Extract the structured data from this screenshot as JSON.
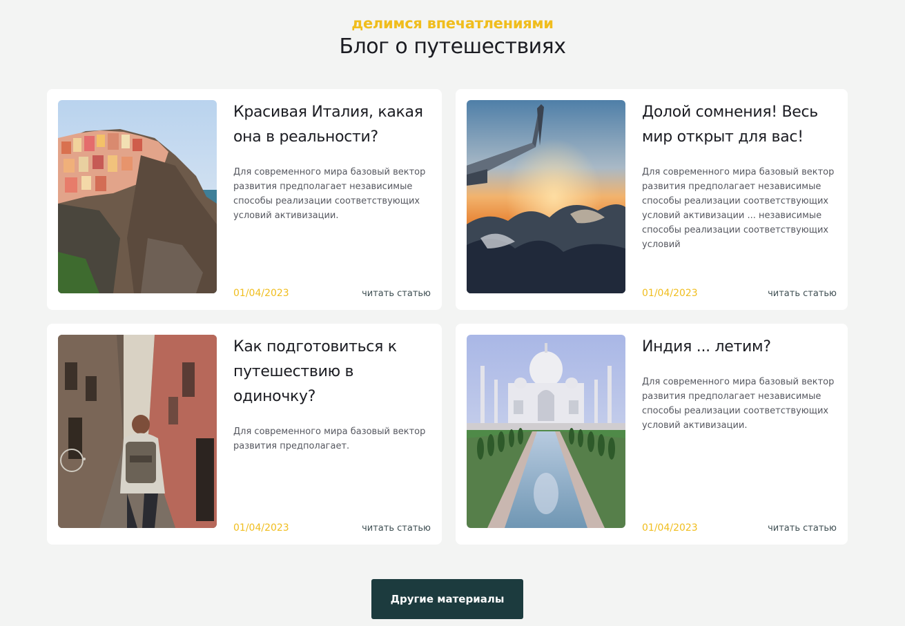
{
  "header": {
    "eyebrow": "делимся впечатлениями",
    "title": "Блог о путешествиях"
  },
  "posts": [
    {
      "image_icon": "italy-coast-photo",
      "title": "Красивая Италия, какая она в реальности?",
      "text": "Для современного мира базовый вектор развития предполагает независимые способы реализации соответствующих условий активизации.",
      "date": "01/04/2023",
      "link": "читать статью"
    },
    {
      "image_icon": "airplane-wing-photo",
      "title": "Долой сомнения! Весь мир открыт для вас!",
      "text": "Для современного мира базовый вектор развития предполагает независимые способы реализации соответствующих условий активизации ... независимые способы реализации соответствующих условий",
      "date": "01/04/2023",
      "link": "читать статью"
    },
    {
      "image_icon": "traveler-alley-photo",
      "title": "Как подготовиться к путешествию в одиночку?",
      "text": "Для современного мира базовый вектор развития предполагает.",
      "date": "01/04/2023",
      "link": "читать статью"
    },
    {
      "image_icon": "taj-mahal-photo",
      "title": "Индия ... летим?",
      "text": "Для современного мира базовый вектор развития предполагает независимые способы реализации соответствующих условий активизации.",
      "date": "01/04/2023",
      "link": "читать статью"
    }
  ],
  "more_button": "Другие материалы",
  "colors": {
    "accent": "#f0bd1d",
    "button": "#1c3b3e",
    "background": "#f3f4f3"
  }
}
